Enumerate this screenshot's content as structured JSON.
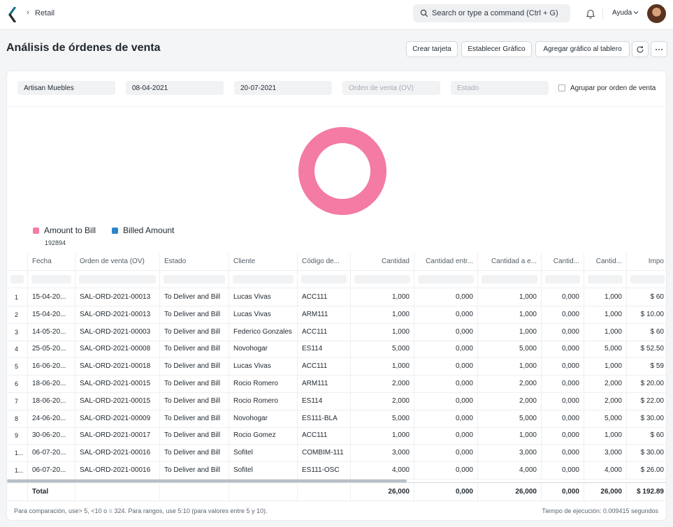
{
  "navbar": {
    "breadcrumb": "Retail",
    "search_placeholder": "Search or type a command (Ctrl + G)",
    "help_label": "Ayuda"
  },
  "page": {
    "title": "Análisis de órdenes de venta",
    "buttons": {
      "create_card": "Crear tarjeta",
      "set_chart": "Establecer Gráfico",
      "add_chart": "Agregar gráfico al tablero",
      "refresh_icon": "refresh-icon",
      "more_icon": "more-icon"
    }
  },
  "filters": {
    "company": "Artisan Muebles",
    "from_date": "08-04-2021",
    "to_date": "20-07-2021",
    "sales_order_placeholder": "Orden de venta (OV)",
    "status_placeholder": "Estado",
    "group_by_label": "Agrupar por orden de venta"
  },
  "colors": {
    "amount_to_bill": "#f47ba3",
    "billed_amount": "#2d85c9"
  },
  "chart_data": {
    "type": "pie",
    "series": [
      {
        "name": "Amount to Bill",
        "value": 192894,
        "color": "#f47ba3"
      },
      {
        "name": "Billed Amount",
        "value": 0,
        "color": "#2d85c9"
      }
    ],
    "legend_value": "192894"
  },
  "table": {
    "columns": [
      "Fecha",
      "Orden de venta (OV)",
      "Estado",
      "Cliente",
      "Código de...",
      "Cantidad",
      "Cantidad entr...",
      "Cantidad a e...",
      "Cantid...",
      "Cantid...",
      "Impo"
    ],
    "rows": [
      [
        "1",
        "15-04-20...",
        "SAL-ORD-2021-00013",
        "To Deliver and Bill",
        "Lucas Vivas",
        "ACC111",
        "1,000",
        "0,000",
        "1,000",
        "0,000",
        "1,000",
        "$ 60"
      ],
      [
        "2",
        "15-04-20...",
        "SAL-ORD-2021-00013",
        "To Deliver and Bill",
        "Lucas Vivas",
        "ARM111",
        "1,000",
        "0,000",
        "1,000",
        "0,000",
        "1,000",
        "$ 10.00"
      ],
      [
        "3",
        "14-05-20...",
        "SAL-ORD-2021-00003",
        "To Deliver and Bill",
        "Federico Gonzales",
        "ACC111",
        "1,000",
        "0,000",
        "1,000",
        "0,000",
        "1,000",
        "$ 60"
      ],
      [
        "4",
        "25-05-20...",
        "SAL-ORD-2021-00008",
        "To Deliver and Bill",
        "Novohogar",
        "ES114",
        "5,000",
        "0,000",
        "5,000",
        "0,000",
        "5,000",
        "$ 52.50"
      ],
      [
        "5",
        "16-06-20...",
        "SAL-ORD-2021-00018",
        "To Deliver and Bill",
        "Lucas Vivas",
        "ACC111",
        "1,000",
        "0,000",
        "1,000",
        "0,000",
        "1,000",
        "$ 59"
      ],
      [
        "6",
        "18-06-20...",
        "SAL-ORD-2021-00015",
        "To Deliver and Bill",
        "Rocio Romero",
        "ARM111",
        "2,000",
        "0,000",
        "2,000",
        "0,000",
        "2,000",
        "$ 20.00"
      ],
      [
        "7",
        "18-06-20...",
        "SAL-ORD-2021-00015",
        "To Deliver and Bill",
        "Rocio Romero",
        "ES114",
        "2,000",
        "0,000",
        "2,000",
        "0,000",
        "2,000",
        "$ 22.00"
      ],
      [
        "8",
        "24-06-20...",
        "SAL-ORD-2021-00009",
        "To Deliver and Bill",
        "Novohogar",
        "ES111-BLA",
        "5,000",
        "0,000",
        "5,000",
        "0,000",
        "5,000",
        "$ 30.00"
      ],
      [
        "9",
        "30-06-20...",
        "SAL-ORD-2021-00017",
        "To Deliver and Bill",
        "Rocio Gomez",
        "ACC111",
        "1,000",
        "0,000",
        "1,000",
        "0,000",
        "1,000",
        "$ 60"
      ],
      [
        "1...",
        "06-07-20...",
        "SAL-ORD-2021-00016",
        "To Deliver and Bill",
        "Sofitel",
        "COMBIM-111",
        "3,000",
        "0,000",
        "3,000",
        "0,000",
        "3,000",
        "$ 30.00"
      ],
      [
        "1...",
        "06-07-20...",
        "SAL-ORD-2021-00016",
        "To Deliver and Bill",
        "Sofitel",
        "ES111-OSC",
        "4,000",
        "0,000",
        "4,000",
        "0,000",
        "4,000",
        "$ 26.00"
      ]
    ],
    "total": [
      "",
      "Total",
      "",
      "",
      "",
      "",
      "26,000",
      "0,000",
      "26,000",
      "0,000",
      "26,000",
      "$ 192.89"
    ]
  },
  "footer": {
    "hint": "Para comparación, use> 5, <10 o = 324. Para rangos, use 5:10 (para valores entre 5 y 10).",
    "exec_time": "Tiempo de ejecución: 0.009415 segundos"
  }
}
